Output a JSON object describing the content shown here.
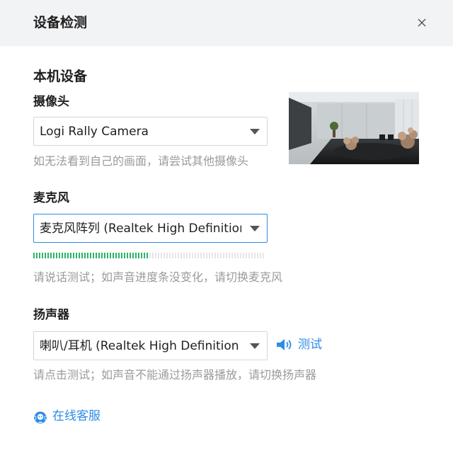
{
  "dialog": {
    "title": "设备检测",
    "close_icon": "close-icon"
  },
  "section": {
    "title": "本机设备"
  },
  "camera": {
    "label": "摄像头",
    "selected": "Logi Rally Camera",
    "hint": "如无法看到自己的画面，请尝试其他摄像头"
  },
  "microphone": {
    "label": "麦克风",
    "selected": "麦克风阵列 (Realtek High Definition Audio)",
    "hint": "请说话测试；如声音进度条没变化，请切换麦克风",
    "level_fraction": 0.5
  },
  "speaker": {
    "label": "扬声器",
    "selected": "喇叭/耳机 (Realtek High Definition Audio)",
    "test_label": "测试",
    "hint": "请点击测试；如声音不能通过扬声器播放，请切换扬声器"
  },
  "service": {
    "label": "在线客服"
  },
  "colors": {
    "accent": "#2e8ce6",
    "meter_active": "#2bb36a",
    "meter_inactive": "#e6e6e6",
    "hint": "#9a9a9a",
    "header_bg": "#f2f3f5"
  }
}
